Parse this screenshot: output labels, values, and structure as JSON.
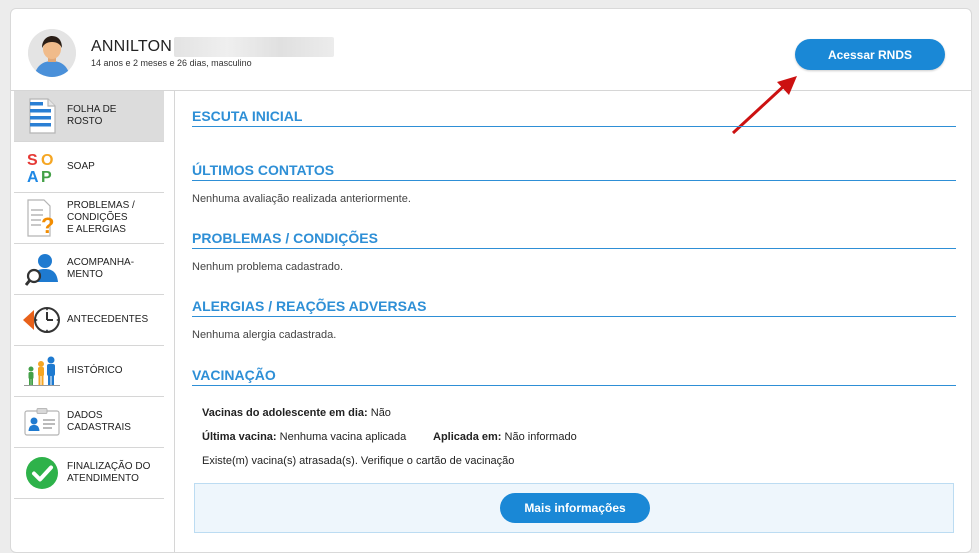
{
  "patient": {
    "name": "ANNILTON",
    "info": "14 anos e 2 meses e 26 dias, masculino"
  },
  "header": {
    "rnds_button": "Acessar RNDS"
  },
  "sidebar": {
    "items": [
      {
        "label": "Folha de\nrosto",
        "icon": "document-lines-icon"
      },
      {
        "label": "SOAP",
        "icon": "soap-icon"
      },
      {
        "label": "Problemas /\ncondições\ne alergias",
        "icon": "question-document-icon"
      },
      {
        "label": "Acompanha-\nmento",
        "icon": "person-search-icon"
      },
      {
        "label": "Antecedentes",
        "icon": "clock-back-icon"
      },
      {
        "label": "Histórico",
        "icon": "family-icon"
      },
      {
        "label": "Dados\ncadastrais",
        "icon": "id-card-icon"
      },
      {
        "label": "Finalização do\natendimento",
        "icon": "check-circle-icon"
      }
    ]
  },
  "sections": {
    "escuta": {
      "title": "ESCUTA INICIAL"
    },
    "contatos": {
      "title": "ÚLTIMOS CONTATOS",
      "text": "Nenhuma avaliação realizada anteriormente."
    },
    "problemas": {
      "title": "PROBLEMAS / CONDIÇÕES",
      "text": "Nenhum problema cadastrado."
    },
    "alergias": {
      "title": "ALERGIAS / REAÇÕES ADVERSAS",
      "text": "Nenhuma alergia cadastrada."
    },
    "vacinacao": {
      "title": "VACINAÇÃO",
      "em_dia_label": "Vacinas do adolescente em dia:",
      "em_dia_value": "Não",
      "ultima_label": "Última vacina:",
      "ultima_value": "Nenhuma vacina aplicada",
      "aplicada_label": "Aplicada em:",
      "aplicada_value": "Não informado",
      "atrasada_text": "Existe(m) vacina(s) atrasada(s). Verifique o cartão de vacinação",
      "more_button": "Mais informações"
    }
  },
  "colors": {
    "accent": "#1a88d6",
    "section_title": "#2e8fd6",
    "arrow": "#cc1111"
  }
}
